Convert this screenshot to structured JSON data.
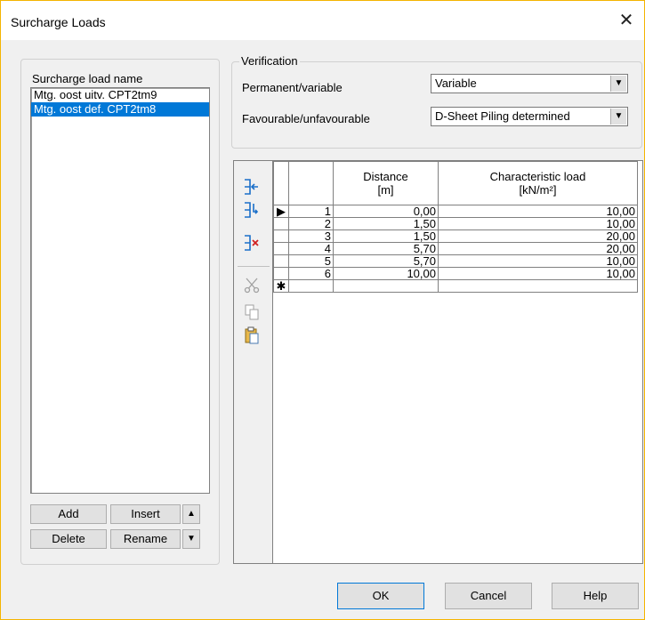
{
  "window": {
    "title": "Surcharge Loads"
  },
  "left_group": {
    "list_label": "Surcharge load name",
    "items": [
      "Mtg. oost uitv. CPT2tm9",
      "Mtg. oost def. CPT2tm8"
    ],
    "selected_index": 1,
    "buttons": {
      "add": "Add",
      "insert": "Insert",
      "delete": "Delete",
      "rename": "Rename"
    }
  },
  "verification": {
    "group_label": "Verification",
    "permanent_label": "Permanent/variable",
    "permanent_value": "Variable",
    "favourable_label": "Favourable/unfavourable",
    "favourable_value": "D-Sheet Piling determined"
  },
  "toolbar": {
    "icons": [
      "add-row-icon",
      "insert-row-icon",
      "delete-row-icon",
      "cut-icon",
      "copy-icon",
      "paste-icon"
    ]
  },
  "table": {
    "headers": {
      "distance": "Distance\n[m]",
      "load": "Characteristic load\n[kN/m²]"
    },
    "rows": [
      {
        "n": "1",
        "distance": "0,00",
        "load": "10,00"
      },
      {
        "n": "2",
        "distance": "1,50",
        "load": "10,00"
      },
      {
        "n": "3",
        "distance": "1,50",
        "load": "20,00"
      },
      {
        "n": "4",
        "distance": "5,70",
        "load": "20,00"
      },
      {
        "n": "5",
        "distance": "5,70",
        "load": "10,00"
      },
      {
        "n": "6",
        "distance": "10,00",
        "load": "10,00"
      }
    ],
    "current_marker": "▶",
    "new_row_marker": "✱"
  },
  "footer": {
    "ok": "OK",
    "cancel": "Cancel",
    "help": "Help"
  }
}
